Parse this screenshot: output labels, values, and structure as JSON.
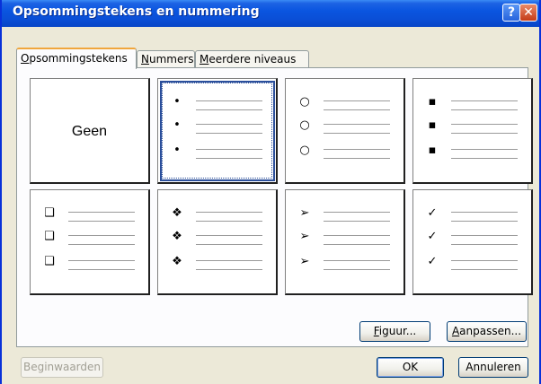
{
  "window": {
    "title": "Opsommingstekens en nummering",
    "help_symbol": "?",
    "close_symbol": "✕"
  },
  "tabs": [
    {
      "label": "Opsommingstekens",
      "mnemonic": "O",
      "rest": "psommingstekens",
      "active": true
    },
    {
      "label": "Nummers",
      "mnemonic": "N",
      "rest": "ummers",
      "active": false
    },
    {
      "label": "Meerdere niveaus",
      "mnemonic": "M",
      "rest": "eerdere niveaus",
      "active": false
    }
  ],
  "bullet_styles": [
    {
      "name": "geen",
      "label": "Geen",
      "symbol": "",
      "selected": false
    },
    {
      "name": "filled-dot",
      "symbol": "•",
      "selected": true
    },
    {
      "name": "hollow-circle",
      "symbol": "○",
      "selected": false
    },
    {
      "name": "filled-square",
      "symbol": "▪",
      "selected": false
    },
    {
      "name": "hollow-square",
      "symbol": "❑",
      "selected": false
    },
    {
      "name": "four-diamond",
      "symbol": "❖",
      "selected": false
    },
    {
      "name": "arrowhead",
      "symbol": "➢",
      "selected": false
    },
    {
      "name": "checkmark",
      "symbol": "✓",
      "selected": false
    }
  ],
  "buttons": {
    "figuur": {
      "mnemonic": "F",
      "rest": "iguur..."
    },
    "aanpassen": {
      "mnemonic": "A",
      "rest": "anpassen..."
    },
    "beginwaarden": "Beginwaarden",
    "ok": "OK",
    "annuleren": "Annuleren"
  }
}
